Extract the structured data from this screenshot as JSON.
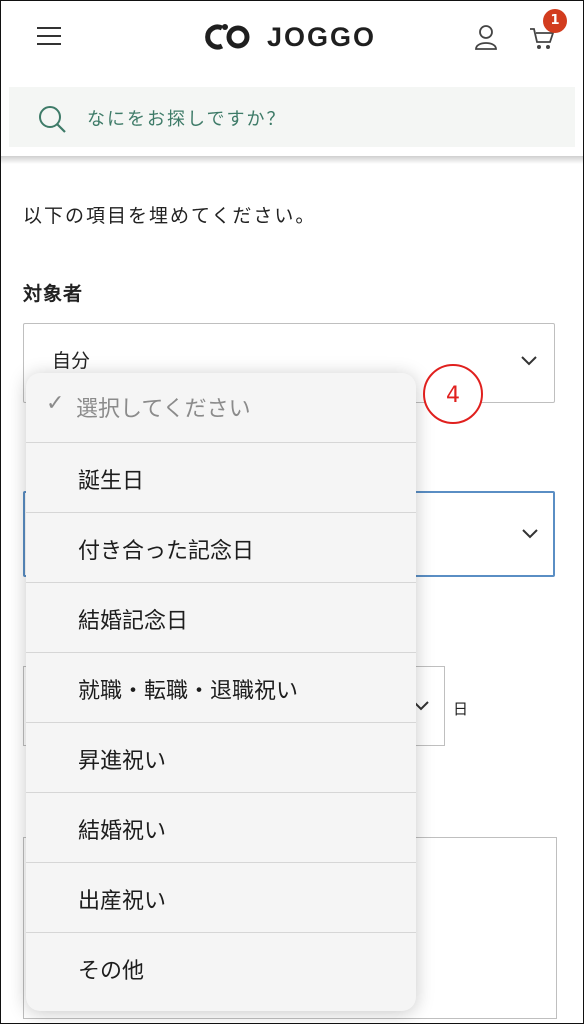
{
  "header": {
    "logo_text": "JOGGO",
    "cart_count": "1",
    "icons": [
      "hamburger-menu-icon",
      "logo-mark-icon",
      "user-icon",
      "cart-icon"
    ]
  },
  "search": {
    "placeholder": "なにをお探しですか？"
  },
  "form": {
    "intro": "以下の項目を埋めてください。",
    "recipient_label": "対象者",
    "recipient_value": "自分",
    "day_label": "日"
  },
  "dropdown": {
    "placeholder": "選択してください",
    "check_mark": "✓",
    "options": [
      "誕生日",
      "付き合った記念日",
      "結婚記念日",
      "就職・転職・退職祝い",
      "昇進祝い",
      "結婚祝い",
      "出産祝い",
      "その他"
    ]
  },
  "annotation": {
    "step_number": "4",
    "color": "#e0201e"
  },
  "colors": {
    "search_text": "#3e7b68",
    "badge": "#d23c1e",
    "focus_border": "#5a8ec4"
  }
}
